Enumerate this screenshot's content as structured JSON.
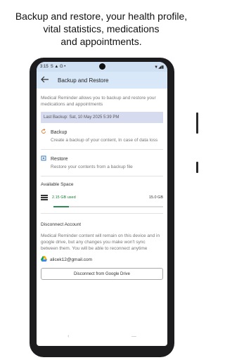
{
  "caption": {
    "line1": "Backup and restore, your health profile,",
    "line2": "vital statistics, medications",
    "line3": "and appointments."
  },
  "statusbar": {
    "time": "3:15",
    "left_icons": "S ▲ G •",
    "right_icons": "▼◢▮"
  },
  "appbar": {
    "back_icon": "arrow-left-icon",
    "title": "Backup and Restore"
  },
  "main": {
    "description": "Medical Reminder allows you to backup and restore your medications and appointments",
    "last_backup": "Last Backup: Sat, 10 May 2025   5:39 PM",
    "backup": {
      "title": "Backup",
      "subtitle": "Create a backup of your content, In case of data loss"
    },
    "restore": {
      "title": "Restore",
      "subtitle": "Restore your contents from a backup file"
    },
    "space": {
      "title": "Available Space",
      "used": "2.15 GB used",
      "total": "15.0 GB",
      "used_fraction": 0.143,
      "bar_color": "#2e8b57"
    },
    "disconnect": {
      "title": "Disconnect Account",
      "description": "Medical Reminder content will remain on this device and in google drive, but any changes you make won't sync between them. You will be able to reconnect anytime",
      "email": "alicek12@gmail.com",
      "button_label": "Disconnect from Google Drive"
    }
  },
  "navbar": {
    "back": "‹",
    "home": "—"
  },
  "colors": {
    "appbar_bg": "#d8e8f8",
    "last_backup_bg": "#d7dbf0",
    "backup_icon": "#e07a2a",
    "restore_icon": "#2b6fb3"
  }
}
